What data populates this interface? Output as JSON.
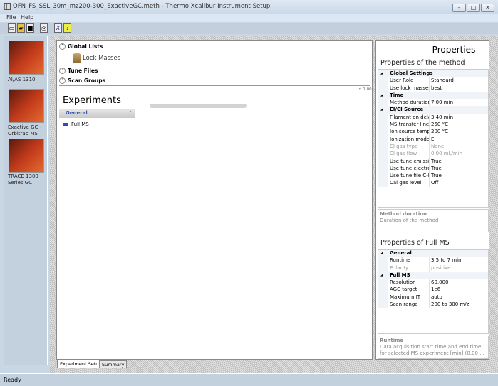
{
  "window": {
    "title": "OFN_FS_SSL_30m_mz200-300_ExactiveGC.meth - Thermo Xcalibur Instrument Setup",
    "min": "–",
    "max": "□",
    "close": "✕"
  },
  "menu": [
    "File",
    "Help"
  ],
  "toolbar": [
    {
      "icon": "new-icon",
      "glyph": "▭"
    },
    {
      "icon": "open-icon",
      "glyph": "▰"
    },
    {
      "icon": "save-icon",
      "glyph": "■"
    },
    {
      "icon": "print-icon",
      "glyph": "⎙"
    },
    {
      "icon": "cut-icon",
      "glyph": "X"
    },
    {
      "icon": "help-icon",
      "glyph": "?"
    }
  ],
  "instruments": [
    {
      "label": "AI/AS 1310"
    },
    {
      "label": "Exactive GC - Orbitrap MS"
    },
    {
      "label": "TRACE 1300 Series GC"
    }
  ],
  "global": {
    "global_lists": "Global Lists",
    "lock_masses": "Lock Masses",
    "tune_files": "Tune Files",
    "scan_groups": "Scan Groups",
    "zoom": "× 1.00"
  },
  "experiments": {
    "title": "Experiments",
    "group": "General",
    "items": [
      "Full MS"
    ]
  },
  "properties": {
    "title": "Properties",
    "method_title": "Properties of the method",
    "method_rows": [
      {
        "cat": true,
        "k": "Global Settings"
      },
      {
        "k": "User Role",
        "v": "Standard"
      },
      {
        "k": "Use lock masses",
        "v": "best"
      },
      {
        "cat": true,
        "k": "Time"
      },
      {
        "k": "Method duration",
        "v": "7.00 min"
      },
      {
        "cat": true,
        "k": "EI/CI Source"
      },
      {
        "k": "Filament on delay",
        "v": "3.40 min"
      },
      {
        "k": "MS transfer line",
        "v": "250 °C"
      },
      {
        "k": "Ion source temp",
        "v": "200 °C"
      },
      {
        "k": "Ionization mode",
        "v": "EI"
      },
      {
        "k": "CI gas type",
        "v": "None",
        "dis": true
      },
      {
        "k": "CI gas flow",
        "v": "0.00 mL/min",
        "dis": true
      },
      {
        "k": "Use tune emission",
        "v": "True"
      },
      {
        "k": "Use tune electron",
        "v": "True"
      },
      {
        "k": "Use tune file C-I",
        "v": "True"
      },
      {
        "k": "Cal gas level",
        "v": "Off"
      }
    ],
    "method_desc_title": "Method duration",
    "method_desc": "Duration of the method",
    "fullms_title": "Properties of Full MS",
    "fullms_rows": [
      {
        "cat": true,
        "k": "General"
      },
      {
        "k": "Runtime",
        "v": "3.5 to 7 min"
      },
      {
        "k": "Polarity",
        "v": "positive",
        "dis": true
      },
      {
        "cat": true,
        "k": "Full MS"
      },
      {
        "k": "Resolution",
        "v": "60,000"
      },
      {
        "k": "AGC target",
        "v": "1e6"
      },
      {
        "k": "Maximum IT",
        "v": "auto"
      },
      {
        "k": "Scan range",
        "v": "200 to 300 m/z"
      }
    ],
    "fullms_desc_title": "Runtime",
    "fullms_desc": "Data acquisition start time and end time for selected MS experiment [min] (0.00 ..."
  },
  "tabs": [
    "Experiment Setup",
    "Summary"
  ],
  "status": "Ready"
}
